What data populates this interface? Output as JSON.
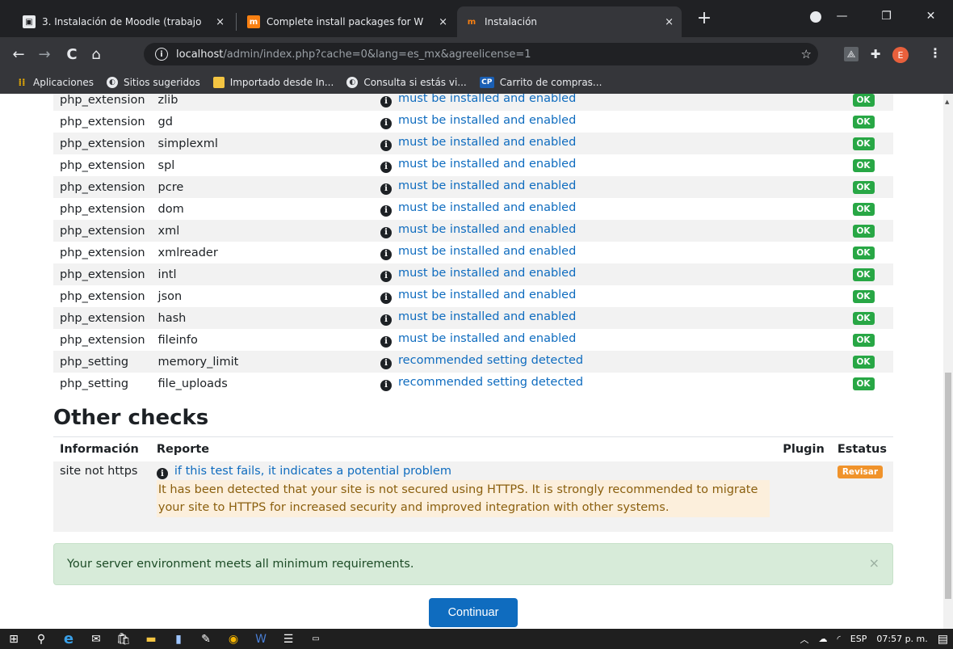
{
  "browser": {
    "tabs": [
      {
        "title": "3. Instalación de Moodle (trabajo",
        "favicon": "classroom-icon",
        "active": false
      },
      {
        "title": "Complete install packages for W",
        "favicon": "moodle-icon",
        "active": false
      },
      {
        "title": "Instalación",
        "favicon": "moodle-icon",
        "active": true
      }
    ],
    "close_glyph": "×",
    "new_tab_glyph": "+",
    "address": {
      "host": "localhost",
      "path": "/admin/index.php?cache=0&lang=es_mx&agreelicense=1"
    },
    "avatar_letter": "E",
    "bookmarks": [
      {
        "label": "Aplicaciones",
        "icon": "apps-grid-icon"
      },
      {
        "label": "Sitios sugeridos",
        "icon": "globe-icon"
      },
      {
        "label": "Importado desde In...",
        "icon": "folder-icon"
      },
      {
        "label": "Consulta si estás vi...",
        "icon": "globe-icon"
      },
      {
        "label": "Carrito de compras...",
        "icon": "cp-icon",
        "icon_text": "CP"
      }
    ]
  },
  "environment": {
    "rows": [
      {
        "type": "php_extension",
        "name": "zlib",
        "report": "must be installed and enabled",
        "status": "OK"
      },
      {
        "type": "php_extension",
        "name": "gd",
        "report": "must be installed and enabled",
        "status": "OK"
      },
      {
        "type": "php_extension",
        "name": "simplexml",
        "report": "must be installed and enabled",
        "status": "OK"
      },
      {
        "type": "php_extension",
        "name": "spl",
        "report": "must be installed and enabled",
        "status": "OK"
      },
      {
        "type": "php_extension",
        "name": "pcre",
        "report": "must be installed and enabled",
        "status": "OK"
      },
      {
        "type": "php_extension",
        "name": "dom",
        "report": "must be installed and enabled",
        "status": "OK"
      },
      {
        "type": "php_extension",
        "name": "xml",
        "report": "must be installed and enabled",
        "status": "OK"
      },
      {
        "type": "php_extension",
        "name": "xmlreader",
        "report": "must be installed and enabled",
        "status": "OK"
      },
      {
        "type": "php_extension",
        "name": "intl",
        "report": "must be installed and enabled",
        "status": "OK"
      },
      {
        "type": "php_extension",
        "name": "json",
        "report": "must be installed and enabled",
        "status": "OK"
      },
      {
        "type": "php_extension",
        "name": "hash",
        "report": "must be installed and enabled",
        "status": "OK"
      },
      {
        "type": "php_extension",
        "name": "fileinfo",
        "report": "must be installed and enabled",
        "status": "OK"
      },
      {
        "type": "php_setting",
        "name": "memory_limit",
        "report": "recommended setting detected",
        "status": "OK"
      },
      {
        "type": "php_setting",
        "name": "file_uploads",
        "report": "recommended setting detected",
        "status": "OK"
      }
    ]
  },
  "other_checks": {
    "title": "Other checks",
    "headers": {
      "info": "Información",
      "report": "Reporte",
      "plugin": "Plugin",
      "status": "Estatus"
    },
    "row": {
      "info": "site not https",
      "report": "if this test fails, it indicates a potential problem",
      "warning": "It has been detected that your site is not secured using HTTPS. It is strongly recommended to migrate your site to HTTPS for increased security and improved integration with other systems.",
      "plugin": "",
      "status": "Revisar"
    }
  },
  "alert": {
    "message": "Your server environment meets all minimum requirements.",
    "close": "×"
  },
  "continue_label": "Continuar",
  "taskbar": {
    "language": "ESP",
    "time": "07:57 p. m."
  },
  "colors": {
    "link": "#0f6cbf",
    "ok": "#28a745",
    "warn": "#f0932b",
    "success_bg": "#d7ebd9"
  }
}
